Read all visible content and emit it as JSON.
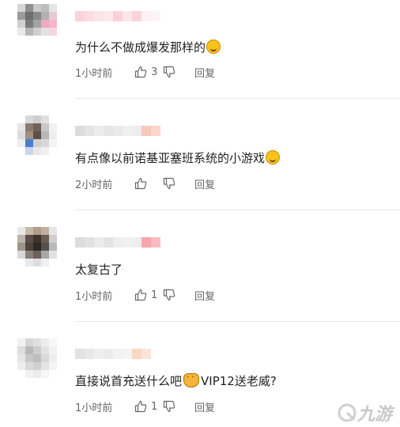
{
  "comments": [
    {
      "text": "为什么不做成爆发那样的",
      "emoji": "laughing-crying-emoji",
      "time": "1小时前",
      "likes": "3",
      "reply_label": "回复"
    },
    {
      "text": "有点像以前诺基亚塞班系统的小游戏",
      "emoji": "laughing-crying-emoji",
      "time": "2小时前",
      "likes": "",
      "reply_label": "回复"
    },
    {
      "text": "太复古了",
      "time": "1小时前",
      "likes": "1",
      "reply_label": "回复"
    },
    {
      "text_before": "直接说首充送什么吧",
      "emoji": "cat-emoji",
      "text_after": "VIP12送老威?",
      "time": "1小时前",
      "likes": "1",
      "reply_label": "回复"
    }
  ],
  "watermark": "九游",
  "colors": {
    "text": "#222222",
    "meta": "#666666",
    "divider": "#e8e8e8"
  }
}
